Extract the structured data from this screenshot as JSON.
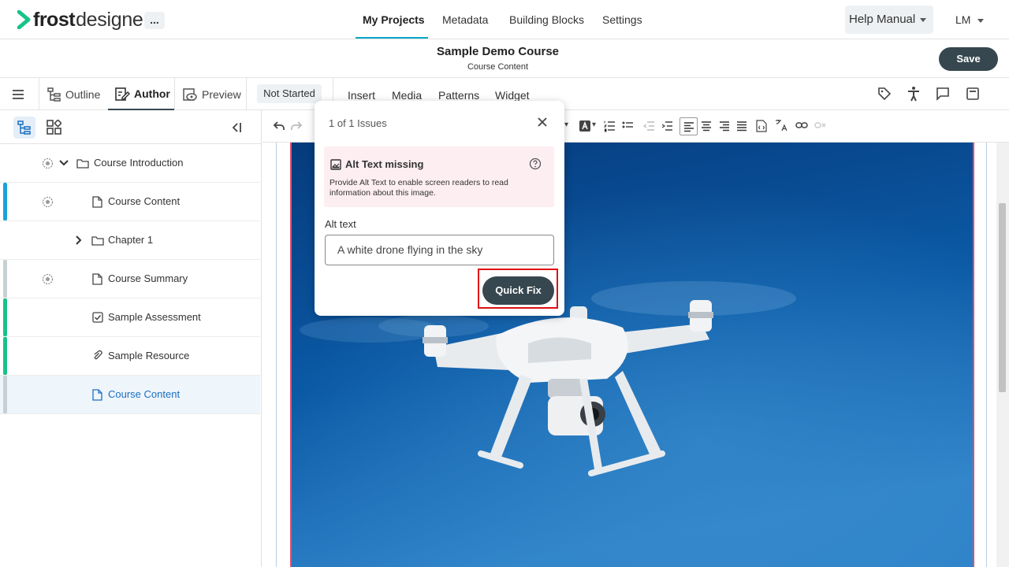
{
  "app": {
    "logo_bold": "frost",
    "logo_light": "designer",
    "more_label": "...",
    "nav_tabs": [
      "My Projects",
      "Metadata",
      "Building Blocks",
      "Settings"
    ],
    "active_nav": "My Projects",
    "help_label": "Help Manual",
    "user_initials": "LM"
  },
  "course": {
    "title": "Sample Demo Course",
    "subtitle": "Course Content",
    "save_label": "Save"
  },
  "toolbar": {
    "outline_label": "Outline",
    "author_label": "Author",
    "preview_label": "Preview",
    "status": "Not Started",
    "insert_tabs": [
      "Insert",
      "Media",
      "Patterns",
      "Widget"
    ]
  },
  "sidebar": {
    "items": [
      {
        "label": "Course Introduction",
        "icon": "folder-icon",
        "status_color": ""
      },
      {
        "label": "Course Content",
        "icon": "page-icon",
        "status_color": "#1ba3d9"
      },
      {
        "label": "Chapter 1",
        "icon": "folder-icon",
        "status_color": ""
      },
      {
        "label": "Course Summary",
        "icon": "page-icon",
        "status_color": "#c7d0d3"
      },
      {
        "label": "Sample Assessment",
        "icon": "checkbox-icon",
        "status_color": "#18c28a"
      },
      {
        "label": "Sample Resource",
        "icon": "paperclip-icon",
        "status_color": "#18c28a"
      },
      {
        "label": "Course Content",
        "icon": "page-icon",
        "status_color": "#c7d0d3",
        "selected": true
      }
    ]
  },
  "popup": {
    "title": "1 of 1 Issues",
    "issue_title": "Alt Text missing",
    "issue_desc": "Provide Alt Text to enable screen readers to read information about this image.",
    "alt_label": "Alt text",
    "alt_value": "A white drone flying in the sky",
    "quickfix_label": "Quick Fix"
  },
  "colors": {
    "accent": "#0aa6c8",
    "primary_dark": "#37474f",
    "error": "#e01010",
    "issue_bg": "#fdeef2"
  }
}
